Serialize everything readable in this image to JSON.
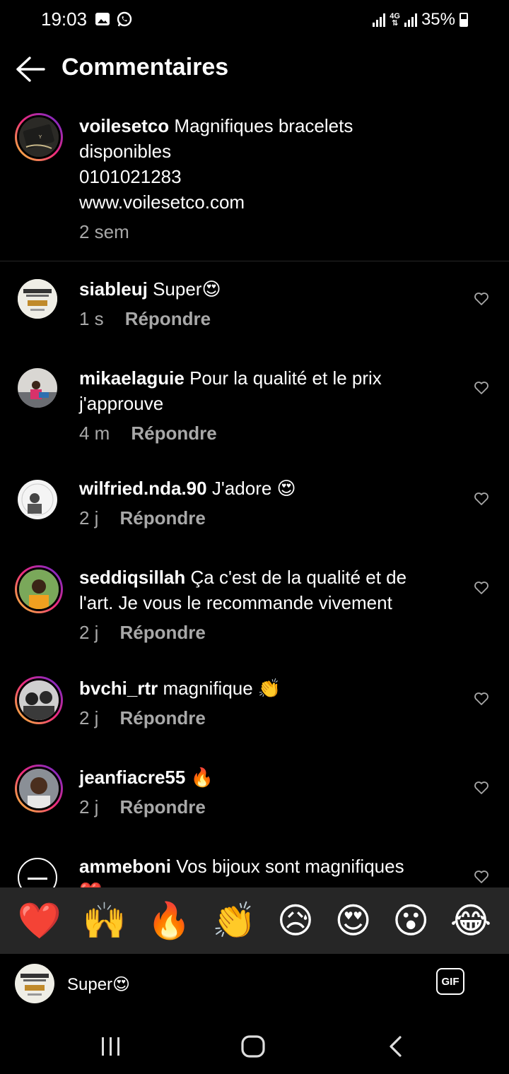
{
  "status_bar": {
    "time": "19:03",
    "network_label": "4G",
    "battery": "35%",
    "icons": [
      "gallery-icon",
      "whatsapp-icon",
      "signal-icon",
      "battery-icon"
    ]
  },
  "header": {
    "title": "Commentaires",
    "back_icon": "arrow-left-icon"
  },
  "caption": {
    "username": "voilesetco",
    "lines": [
      "Magnifiques bracelets",
      "disponibles",
      "0101021283",
      "www.voilesetco.com"
    ],
    "time": "2 sem"
  },
  "comments": [
    {
      "username": "siableuj",
      "text": "Super😍",
      "time": "1 s",
      "reply": "Répondre"
    },
    {
      "username": "mikaelaguie",
      "text": "Pour la qualité et le prix",
      "text2": "j'approuve",
      "time": "4 m",
      "reply": "Répondre"
    },
    {
      "username": "wilfried.nda.90",
      "text": "J'adore 😍",
      "time": "2 j",
      "reply": "Répondre"
    },
    {
      "username": "seddiqsillah",
      "text": "Ça c'est de la qualité et de",
      "text2": "l'art. Je vous le recommande vivement",
      "time": "2 j",
      "reply": "Répondre"
    },
    {
      "username": "bvchi_rtr",
      "text": "magnifique 👏",
      "time": "2 j",
      "reply": "Répondre"
    },
    {
      "username": "jeanfiacre55",
      "text": "🔥",
      "time": "2 j",
      "reply": "Répondre"
    },
    {
      "username": "ammeboni",
      "text": "Vos bijoux sont magnifiques",
      "text2": "❤️"
    }
  ],
  "emoji_bar": [
    "❤️",
    "🙌",
    "🔥",
    "👏",
    "😥",
    "😍",
    "😮",
    "😂"
  ],
  "composer": {
    "value": "Super😍",
    "gif_label": "GIF"
  },
  "colors": {
    "background": "#000000",
    "secondary_text": "#a8a8a8",
    "emoji_bar_bg": "#262626",
    "story_ring": "#ee2a7b"
  }
}
